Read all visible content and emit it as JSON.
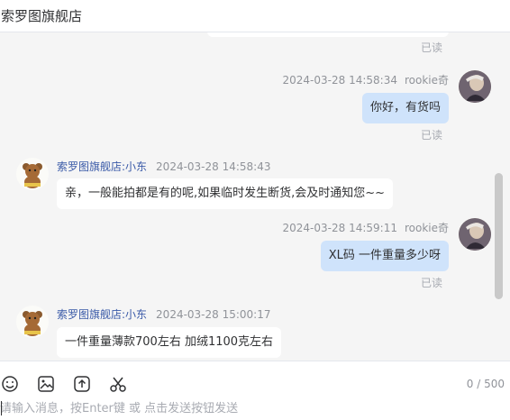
{
  "header": {
    "title": "索罗图旗舰店"
  },
  "messages": {
    "m0": {
      "read": "已读"
    },
    "m1": {
      "time": "2024-03-28 14:58:34",
      "sender": "rookie奇",
      "text": "你好，有货吗",
      "read": "已读"
    },
    "m2": {
      "sender": "索罗图旗舰店:小东",
      "time": "2024-03-28 14:58:43",
      "text": "亲，一般能拍都是有的呢,如果临时发生断货,会及时通知您~~"
    },
    "m3": {
      "time": "2024-03-28 14:59:11",
      "sender": "rookie奇",
      "text": "XL码 一件重量多少呀",
      "read": "已读"
    },
    "m4": {
      "sender": "索罗图旗舰店:小东",
      "time": "2024-03-28 15:00:17",
      "text": "一件重量薄款700左右  加绒1100克左右"
    }
  },
  "toolbar": {
    "icons": [
      "emoji-icon",
      "image-icon",
      "upload-icon",
      "scissors-icon"
    ],
    "counter": "0 / 500"
  },
  "input": {
    "placeholder": "请输入消息，按Enter键 或 点击发送按钮发送"
  },
  "colors": {
    "outgoing_bubble": "#cfe3fb",
    "incoming_bubble": "#ffffff",
    "shop_name": "#3a5aa8"
  }
}
